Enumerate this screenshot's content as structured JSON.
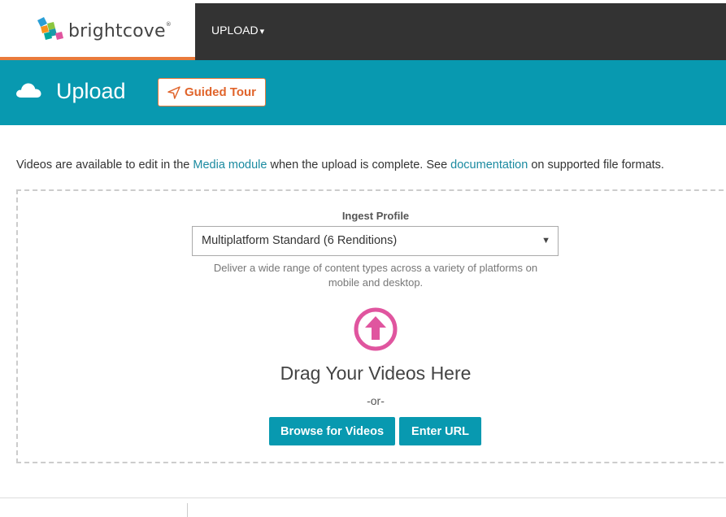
{
  "header": {
    "logo_text": "brightcove",
    "logo_mark": "®",
    "nav_upload_label": "UPLOAD",
    "nav_caret": "▾"
  },
  "banner": {
    "icon": "cloud-icon",
    "title": "Upload",
    "guided_tour_label": "Guided Tour",
    "guided_tour_icon": "navigation-arrow-icon"
  },
  "info": {
    "prefix": "Videos are available to edit in the ",
    "media_link": "Media module",
    "middle": " when the upload is complete. See ",
    "doc_link": "documentation",
    "suffix": " on supported file formats."
  },
  "dropzone": {
    "ingest_label": "Ingest Profile",
    "ingest_selected": "Multiplatform Standard (6 Renditions)",
    "ingest_caret": "▼",
    "ingest_description": "Deliver a wide range of content types across a variety of platforms on mobile and desktop.",
    "upload_icon": "upload-arrow-circle-icon",
    "drag_title": "Drag Your Videos Here",
    "or_text": "-or-",
    "browse_label": "Browse for Videos",
    "url_label": "Enter URL"
  },
  "colors": {
    "teal": "#0899b0",
    "orange": "#e97b3c",
    "pink": "#e0559f",
    "dark": "#333333"
  }
}
